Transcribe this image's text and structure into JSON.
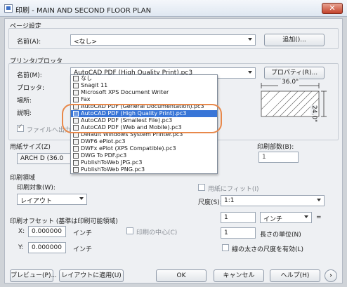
{
  "window": {
    "title": "印刷 - MAIN AND SECOND FLOOR PLAN",
    "close_label": "✕"
  },
  "page_setup": {
    "section": "ページ設定",
    "name_label": "名前(A):",
    "name_value": "<なし>",
    "add_button": "追加()..."
  },
  "printer": {
    "section": "プリンタ/プロッタ",
    "name_label": "名前(M):",
    "name_value": "AutoCAD PDF (High Quality Print).pc3",
    "properties_button": "プロパティ(R)...",
    "plotter_label": "プロッタ:",
    "where_label": "場所:",
    "desc_label": "説明:",
    "print_to_file_label": "ファイルへ出力",
    "preview_dims": {
      "width": "36.0\"",
      "height": "24.0\""
    }
  },
  "dropdown_items": [
    {
      "label": "なし",
      "selected": false
    },
    {
      "label": "Snagit 11",
      "selected": false
    },
    {
      "label": "Microsoft XPS Document Writer",
      "selected": false
    },
    {
      "label": "Fax",
      "selected": false
    },
    {
      "label": "AutoCAD PDF (General Documentation).pc3",
      "selected": false
    },
    {
      "label": "AutoCAD PDF (High Quality Print).pc3",
      "selected": true
    },
    {
      "label": "AutoCAD PDF (Smallest File).pc3",
      "selected": false
    },
    {
      "label": "AutoCAD PDF (Web and Mobile).pc3",
      "selected": false
    },
    {
      "label": "Default Windows System Printer.pc3",
      "selected": false
    },
    {
      "label": "DWF6 ePlot.pc3",
      "selected": false
    },
    {
      "label": "DWFx ePlot (XPS Compatible).pc3",
      "selected": false
    },
    {
      "label": "DWG To PDF.pc3",
      "selected": false
    },
    {
      "label": "PublishToWeb JPG.pc3",
      "selected": false
    },
    {
      "label": "PublishToWeb PNG.pc3",
      "selected": false
    }
  ],
  "paper": {
    "size_label": "用紙サイズ(Z)",
    "size_value": "ARCH D (36.0",
    "copies_label": "印刷部数(B):",
    "copies_value": "1"
  },
  "plot_area": {
    "section": "印刷領域",
    "target_label": "印刷対象(W):",
    "target_value": "レイアウト"
  },
  "scale": {
    "fit_label": "用紙にフィット(I)",
    "scale_label": "尺度(S):",
    "scale_value": "1:1",
    "num_value": "1",
    "unit_value": "インチ",
    "equals": "=",
    "den_value": "1",
    "unit2_label": "長さの単位(N)",
    "lineweight_label": "線の太さの尺度を有効(L)"
  },
  "offset": {
    "section": "印刷オフセット (基準は印刷可能領域)",
    "x_label": "X:",
    "x_value": "0.000000",
    "x_unit": "インチ",
    "center_label": "印刷の中心(C)",
    "y_label": "Y:",
    "y_value": "0.000000",
    "y_unit": "インチ"
  },
  "footer": {
    "preview_button": "プレビュー(P)...",
    "apply_button": "レイアウトに適用(U)",
    "ok_button": "OK",
    "cancel_button": "キャンセル",
    "help_button": "ヘルプ(H)",
    "expand_label": "›"
  }
}
